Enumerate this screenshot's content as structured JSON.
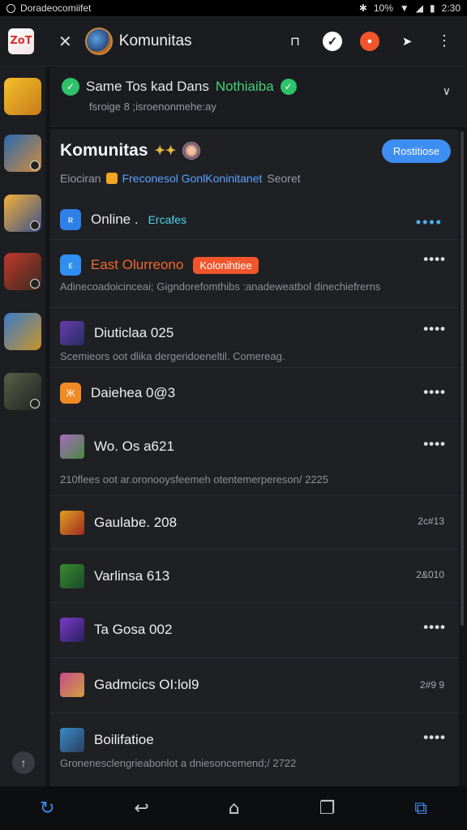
{
  "status": {
    "app": "Doradeocomiifet",
    "battery": "10%",
    "time": "2:30"
  },
  "appbar": {
    "logo_text": "ZoT",
    "title": "Komunitas"
  },
  "banner": {
    "title_a": "Same Tos kad Dans",
    "title_b": "Nothiaiba",
    "subtitle": "fsroige 8 ;isroenonmehe:ay"
  },
  "panel": {
    "title": "Komunitas",
    "register": "Rostitiose",
    "line2_a": "Eiociran",
    "line2_b": "Freconesol GonlKoninitanet",
    "line2_c": "Seoret",
    "online": "Online .",
    "online_tag": "Ercafes"
  },
  "rows": [
    {
      "title": "East Olurreono",
      "chip": "Kolonihtiee",
      "desc": "Adinecoadoicinceai; Gigndorefomthibs :anadeweatbol dinechiefrerns"
    },
    {
      "title": "Diuticlaa 025",
      "desc": "Scemieors oot dlika dergeridoeneltil. Comereag."
    },
    {
      "title": "Daiehea 0@3"
    },
    {
      "title": "Wo. Os a621",
      "desc": "210flees oot ar.oronooysfeemeh otentemerpereson/ 2225"
    },
    {
      "title": "Gaulabe. 208",
      "num": "2c#13"
    },
    {
      "title": "Varlinsa 613",
      "num": "2&010"
    },
    {
      "title": "Ta Gosa 002"
    },
    {
      "title": "Gadmcics OI:lol9",
      "num": "2#9 9"
    },
    {
      "title": "Boilifatioe",
      "desc": "Gronenesclengrieabonlot a dniesoncemend;/ 2722"
    }
  ],
  "colors": {
    "accent": "#3d8ef0",
    "green": "#2ec26a",
    "orange": "#f2552c"
  }
}
